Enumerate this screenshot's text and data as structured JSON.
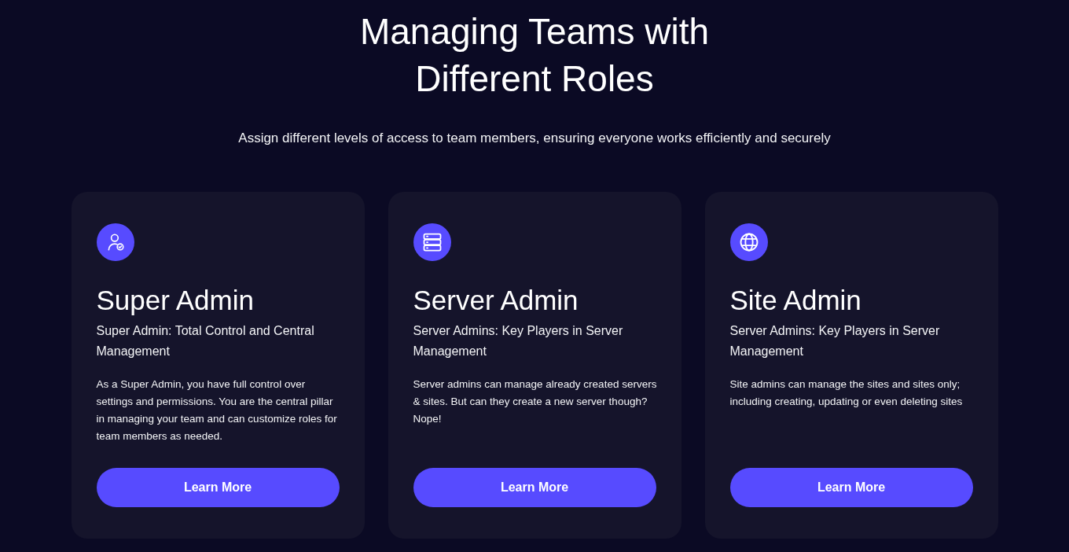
{
  "heading": "Managing Teams with Different Roles",
  "subtitle": "Assign different levels of access to team members, ensuring everyone works efficiently and securely",
  "cards": [
    {
      "kind": "user",
      "title": "Super Admin",
      "subtitle": "Super Admin: Total Control and Central Management",
      "body": "As a Super Admin, you have full control over settings and permissions. You are the central pillar in managing your team and can customize roles for team members as needed.",
      "button": "Learn More"
    },
    {
      "kind": "server",
      "title": "Server Admin",
      "subtitle": "Server Admins: Key Players in Server Management",
      "body": "Server admins can manage already created servers & sites. But can they create a new server though? Nope!",
      "button": "Learn More"
    },
    {
      "kind": "globe",
      "title": "Site Admin",
      "subtitle": "Server Admins: Key Players in Server Management",
      "body": "Site admins can manage the sites and sites only; including creating, updating or even deleting sites",
      "button": "Learn More"
    }
  ]
}
